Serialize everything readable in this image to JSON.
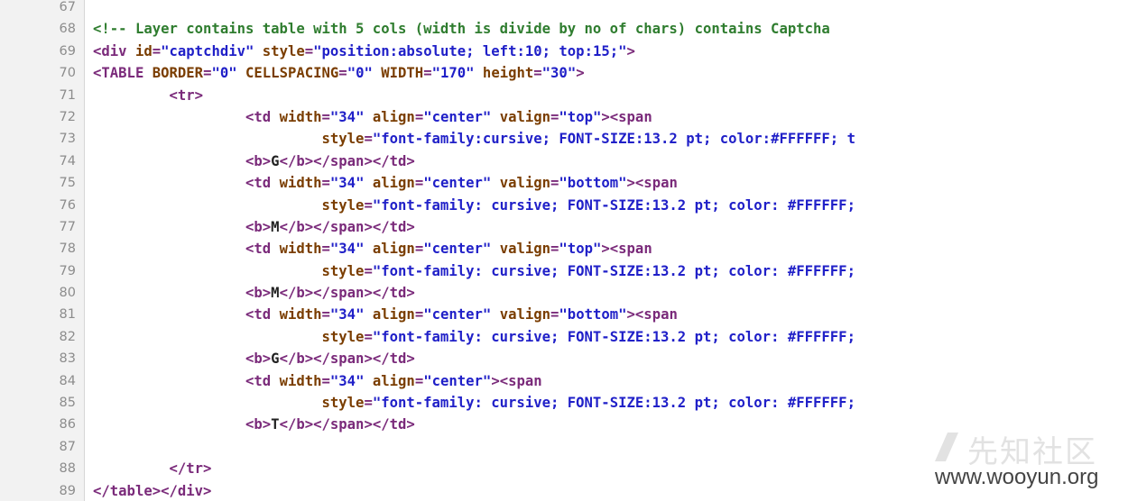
{
  "editor": {
    "lines": [
      {
        "num": "67",
        "tokens": []
      },
      {
        "num": "68",
        "tokens": [
          {
            "t": "comment",
            "v": "<!-- Layer contains table with 5 cols (width is divide by no of chars) contains Captcha"
          }
        ]
      },
      {
        "num": "69",
        "tokens": [
          {
            "t": "tag",
            "v": "<div "
          },
          {
            "t": "attr",
            "v": "id"
          },
          {
            "t": "punct",
            "v": "="
          },
          {
            "t": "str",
            "v": "\"captchdiv\""
          },
          {
            "t": "attr",
            "v": " style"
          },
          {
            "t": "punct",
            "v": "="
          },
          {
            "t": "str",
            "v": "\"position:absolute; left:10; top:15;\""
          },
          {
            "t": "tag",
            "v": ">"
          }
        ]
      },
      {
        "num": "70",
        "tokens": [
          {
            "t": "tag",
            "v": "<TABLE "
          },
          {
            "t": "attr",
            "v": "BORDER"
          },
          {
            "t": "punct",
            "v": "="
          },
          {
            "t": "str",
            "v": "\"0\""
          },
          {
            "t": "attr",
            "v": " CELLSPACING"
          },
          {
            "t": "punct",
            "v": "="
          },
          {
            "t": "str",
            "v": "\"0\""
          },
          {
            "t": "attr",
            "v": " WIDTH"
          },
          {
            "t": "punct",
            "v": "="
          },
          {
            "t": "str",
            "v": "\"170\""
          },
          {
            "t": "attr",
            "v": " height"
          },
          {
            "t": "punct",
            "v": "="
          },
          {
            "t": "str",
            "v": "\"30\""
          },
          {
            "t": "tag",
            "v": ">"
          }
        ]
      },
      {
        "num": "71",
        "tokens": [
          {
            "t": "text",
            "v": "         "
          },
          {
            "t": "tag",
            "v": "<tr>"
          }
        ]
      },
      {
        "num": "72",
        "tokens": [
          {
            "t": "text",
            "v": "                  "
          },
          {
            "t": "tag",
            "v": "<td "
          },
          {
            "t": "attr",
            "v": "width"
          },
          {
            "t": "punct",
            "v": "="
          },
          {
            "t": "str",
            "v": "\"34\""
          },
          {
            "t": "attr",
            "v": " align"
          },
          {
            "t": "punct",
            "v": "="
          },
          {
            "t": "str",
            "v": "\"center\""
          },
          {
            "t": "attr",
            "v": " valign"
          },
          {
            "t": "punct",
            "v": "="
          },
          {
            "t": "str",
            "v": "\"top\""
          },
          {
            "t": "tag",
            "v": "><span"
          }
        ]
      },
      {
        "num": "73",
        "tokens": [
          {
            "t": "text",
            "v": "                           "
          },
          {
            "t": "attr",
            "v": "style"
          },
          {
            "t": "punct",
            "v": "="
          },
          {
            "t": "str",
            "v": "\"font-family:cursive; FONT-SIZE:13.2 pt; color:#FFFFFF; t"
          }
        ]
      },
      {
        "num": "74",
        "tokens": [
          {
            "t": "text",
            "v": "                  "
          },
          {
            "t": "tag",
            "v": "<b>"
          },
          {
            "t": "text",
            "v": "G"
          },
          {
            "t": "tag",
            "v": "</b></span></td>"
          }
        ]
      },
      {
        "num": "75",
        "tokens": [
          {
            "t": "text",
            "v": "                  "
          },
          {
            "t": "tag",
            "v": "<td "
          },
          {
            "t": "attr",
            "v": "width"
          },
          {
            "t": "punct",
            "v": "="
          },
          {
            "t": "str",
            "v": "\"34\""
          },
          {
            "t": "attr",
            "v": " align"
          },
          {
            "t": "punct",
            "v": "="
          },
          {
            "t": "str",
            "v": "\"center\""
          },
          {
            "t": "attr",
            "v": " valign"
          },
          {
            "t": "punct",
            "v": "="
          },
          {
            "t": "str",
            "v": "\"bottom\""
          },
          {
            "t": "tag",
            "v": "><span"
          }
        ]
      },
      {
        "num": "76",
        "tokens": [
          {
            "t": "text",
            "v": "                           "
          },
          {
            "t": "attr",
            "v": "style"
          },
          {
            "t": "punct",
            "v": "="
          },
          {
            "t": "str",
            "v": "\"font-family: cursive; FONT-SIZE:13.2 pt; color: #FFFFFF;"
          }
        ]
      },
      {
        "num": "77",
        "tokens": [
          {
            "t": "text",
            "v": "                  "
          },
          {
            "t": "tag",
            "v": "<b>"
          },
          {
            "t": "text",
            "v": "M"
          },
          {
            "t": "tag",
            "v": "</b></span></td>"
          }
        ]
      },
      {
        "num": "78",
        "tokens": [
          {
            "t": "text",
            "v": "                  "
          },
          {
            "t": "tag",
            "v": "<td "
          },
          {
            "t": "attr",
            "v": "width"
          },
          {
            "t": "punct",
            "v": "="
          },
          {
            "t": "str",
            "v": "\"34\""
          },
          {
            "t": "attr",
            "v": " align"
          },
          {
            "t": "punct",
            "v": "="
          },
          {
            "t": "str",
            "v": "\"center\""
          },
          {
            "t": "attr",
            "v": " valign"
          },
          {
            "t": "punct",
            "v": "="
          },
          {
            "t": "str",
            "v": "\"top\""
          },
          {
            "t": "tag",
            "v": "><span"
          }
        ]
      },
      {
        "num": "79",
        "tokens": [
          {
            "t": "text",
            "v": "                           "
          },
          {
            "t": "attr",
            "v": "style"
          },
          {
            "t": "punct",
            "v": "="
          },
          {
            "t": "str",
            "v": "\"font-family: cursive; FONT-SIZE:13.2 pt; color: #FFFFFF;"
          }
        ]
      },
      {
        "num": "80",
        "tokens": [
          {
            "t": "text",
            "v": "                  "
          },
          {
            "t": "tag",
            "v": "<b>"
          },
          {
            "t": "text",
            "v": "M"
          },
          {
            "t": "tag",
            "v": "</b></span></td>"
          }
        ]
      },
      {
        "num": "81",
        "tokens": [
          {
            "t": "text",
            "v": "                  "
          },
          {
            "t": "tag",
            "v": "<td "
          },
          {
            "t": "attr",
            "v": "width"
          },
          {
            "t": "punct",
            "v": "="
          },
          {
            "t": "str",
            "v": "\"34\""
          },
          {
            "t": "attr",
            "v": " align"
          },
          {
            "t": "punct",
            "v": "="
          },
          {
            "t": "str",
            "v": "\"center\""
          },
          {
            "t": "attr",
            "v": " valign"
          },
          {
            "t": "punct",
            "v": "="
          },
          {
            "t": "str",
            "v": "\"bottom\""
          },
          {
            "t": "tag",
            "v": "><span"
          }
        ]
      },
      {
        "num": "82",
        "tokens": [
          {
            "t": "text",
            "v": "                           "
          },
          {
            "t": "attr",
            "v": "style"
          },
          {
            "t": "punct",
            "v": "="
          },
          {
            "t": "str",
            "v": "\"font-family: cursive; FONT-SIZE:13.2 pt; color: #FFFFFF;"
          }
        ]
      },
      {
        "num": "83",
        "tokens": [
          {
            "t": "text",
            "v": "                  "
          },
          {
            "t": "tag",
            "v": "<b>"
          },
          {
            "t": "text",
            "v": "G"
          },
          {
            "t": "tag",
            "v": "</b></span></td>"
          }
        ]
      },
      {
        "num": "84",
        "tokens": [
          {
            "t": "text",
            "v": "                  "
          },
          {
            "t": "tag",
            "v": "<td "
          },
          {
            "t": "attr",
            "v": "width"
          },
          {
            "t": "punct",
            "v": "="
          },
          {
            "t": "str",
            "v": "\"34\""
          },
          {
            "t": "attr",
            "v": " align"
          },
          {
            "t": "punct",
            "v": "="
          },
          {
            "t": "str",
            "v": "\"center\""
          },
          {
            "t": "tag",
            "v": "><span"
          }
        ]
      },
      {
        "num": "85",
        "tokens": [
          {
            "t": "text",
            "v": "                           "
          },
          {
            "t": "attr",
            "v": "style"
          },
          {
            "t": "punct",
            "v": "="
          },
          {
            "t": "str",
            "v": "\"font-family: cursive; FONT-SIZE:13.2 pt; color: #FFFFFF;"
          }
        ]
      },
      {
        "num": "86",
        "tokens": [
          {
            "t": "text",
            "v": "                  "
          },
          {
            "t": "tag",
            "v": "<b>"
          },
          {
            "t": "text",
            "v": "T"
          },
          {
            "t": "tag",
            "v": "</b></span></td>"
          }
        ]
      },
      {
        "num": "87",
        "tokens": []
      },
      {
        "num": "88",
        "tokens": [
          {
            "t": "text",
            "v": "         "
          },
          {
            "t": "tag",
            "v": "</tr>"
          }
        ]
      },
      {
        "num": "89",
        "tokens": [
          {
            "t": "tag",
            "v": "</table></div>"
          }
        ]
      }
    ]
  },
  "watermark": {
    "site_cn": "先知社区",
    "url": "www.wooyun.org"
  },
  "colors": {
    "comment": "#2f7d2f",
    "tag": "#7a2a7a",
    "attr": "#7a3d00",
    "string": "#2020c8",
    "gutter_bg": "#f2f2f2",
    "line_number": "#8c8c8c"
  }
}
